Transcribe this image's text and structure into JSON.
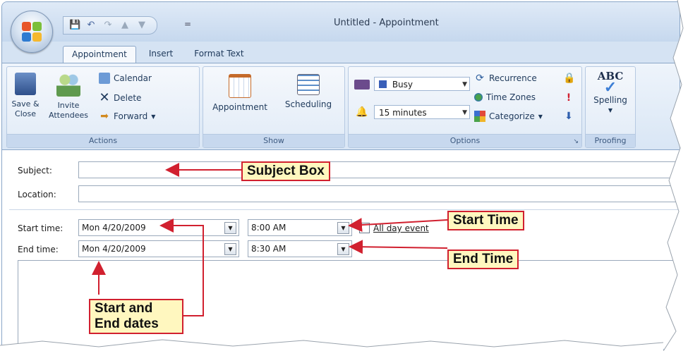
{
  "window": {
    "title": "Untitled - Appointment"
  },
  "qat": {
    "separator": "="
  },
  "tabs": [
    "Appointment",
    "Insert",
    "Format Text"
  ],
  "ribbon": {
    "actions": {
      "label": "Actions",
      "save_close": "Save & Close",
      "invite": "Invite Attendees",
      "calendar": "Calendar",
      "delete": "Delete",
      "forward": "Forward"
    },
    "show": {
      "label": "Show",
      "appointment": "Appointment",
      "scheduling": "Scheduling"
    },
    "options": {
      "label": "Options",
      "busy": "Busy",
      "reminder": "15 minutes",
      "recurrence": "Recurrence",
      "time_zones": "Time Zones",
      "categorize": "Categorize"
    },
    "proofing": {
      "label": "Proofing",
      "spelling": "Spelling",
      "abc": "ABC"
    }
  },
  "form": {
    "subject_label": "Subject:",
    "subject_value": "",
    "location_label": "Location:",
    "location_value": "",
    "start_label": "Start time:",
    "start_date": "Mon 4/20/2009",
    "start_time": "8:00 AM",
    "all_day_label": "All day event",
    "all_day_checked": false,
    "end_label": "End time:",
    "end_date": "Mon 4/20/2009",
    "end_time": "8:30 AM"
  },
  "callouts": {
    "subject_box": "Subject Box",
    "start_time": "Start Time",
    "end_time": "End Time",
    "dates_line1": "Start and",
    "dates_line2": "End dates"
  },
  "colors": {
    "callout_border": "#d1202f",
    "callout_fill": "#fff7bf",
    "ribbon_highlight": "#ffc84b"
  }
}
